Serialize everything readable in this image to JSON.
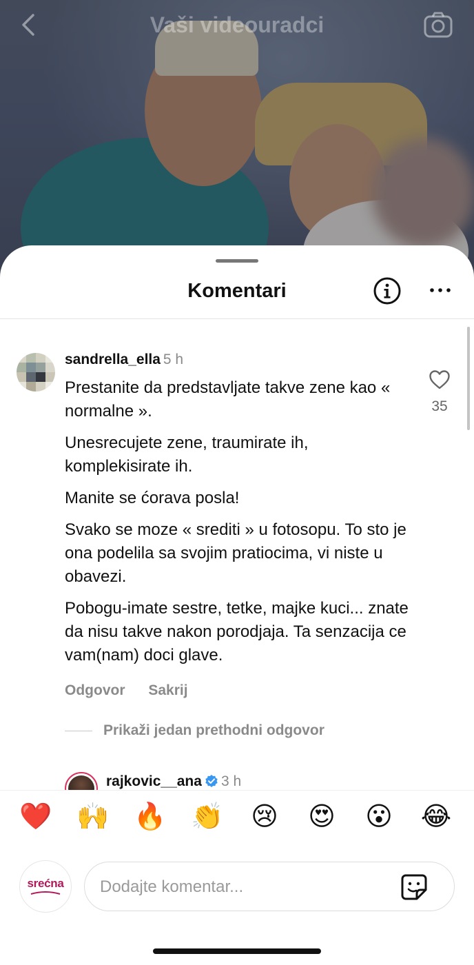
{
  "nav": {
    "title": "Vaši videouradci",
    "back_icon": "chevron-left-icon",
    "camera_icon": "camera-icon"
  },
  "sheet": {
    "title": "Komentari",
    "info_icon": "info-icon",
    "more_icon": "more-icon"
  },
  "comment": {
    "username": "sandrella_ella",
    "time": "5 h",
    "paragraphs": [
      "Prestanite da predstavljate takve zene kao « normalne ».",
      "Unesrecujete zene, traumirate ih, komplekisirate ih.",
      "Manite se ćorava posla!",
      "Svako se moze « srediti » u fotosopu. To sto je ona podelila sa svojim pratiocima, vi niste u obavezi.",
      "Pobogu-imate sestre, tetke,  majke kuci... znate da nisu takve nakon porodjaja. Ta senzacija ce vam(nam) doci glave."
    ],
    "like_count": "35",
    "reply_label": "Odgovor",
    "hide_label": "Sakrij",
    "show_replies_label": "Prikaži jedan prethodni odgovor"
  },
  "reply": {
    "username": "rajkovic__ana",
    "time": "3 h"
  },
  "emoji_bar": [
    "❤️",
    "🙌",
    "🔥",
    "👏",
    "😢",
    "😍",
    "😮",
    "😂"
  ],
  "composer": {
    "brand": "srećna",
    "placeholder": "Dodajte komentar..."
  },
  "colors": {
    "accent_brand": "#b0185a",
    "verified": "#3897f0",
    "muted_text": "#8a8a8a"
  }
}
